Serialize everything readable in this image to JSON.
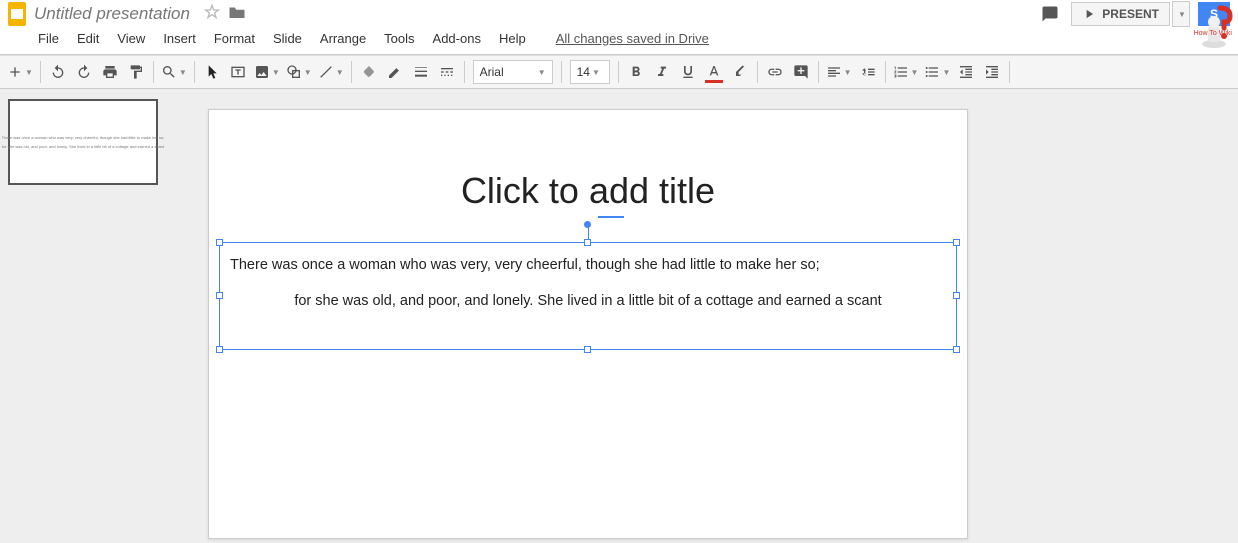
{
  "header": {
    "doc_title": "Untitled presentation",
    "present_label": "PRESENT",
    "share_label": "S",
    "save_status": "All changes saved in Drive"
  },
  "menu": {
    "items": [
      "File",
      "Edit",
      "View",
      "Insert",
      "Format",
      "Slide",
      "Arrange",
      "Tools",
      "Add-ons",
      "Help"
    ]
  },
  "toolbar": {
    "font_name": "Arial",
    "font_size": "14"
  },
  "slide": {
    "title_placeholder": "Click to add title",
    "body_line1": "There was once a woman who was very, very cheerful, though she had little to make her so;",
    "body_line2": "for she was old, and poor, and lonely. She lived in a little bit of a cottage and earned a scant"
  },
  "watermark": {
    "text": "How To Wiki"
  }
}
